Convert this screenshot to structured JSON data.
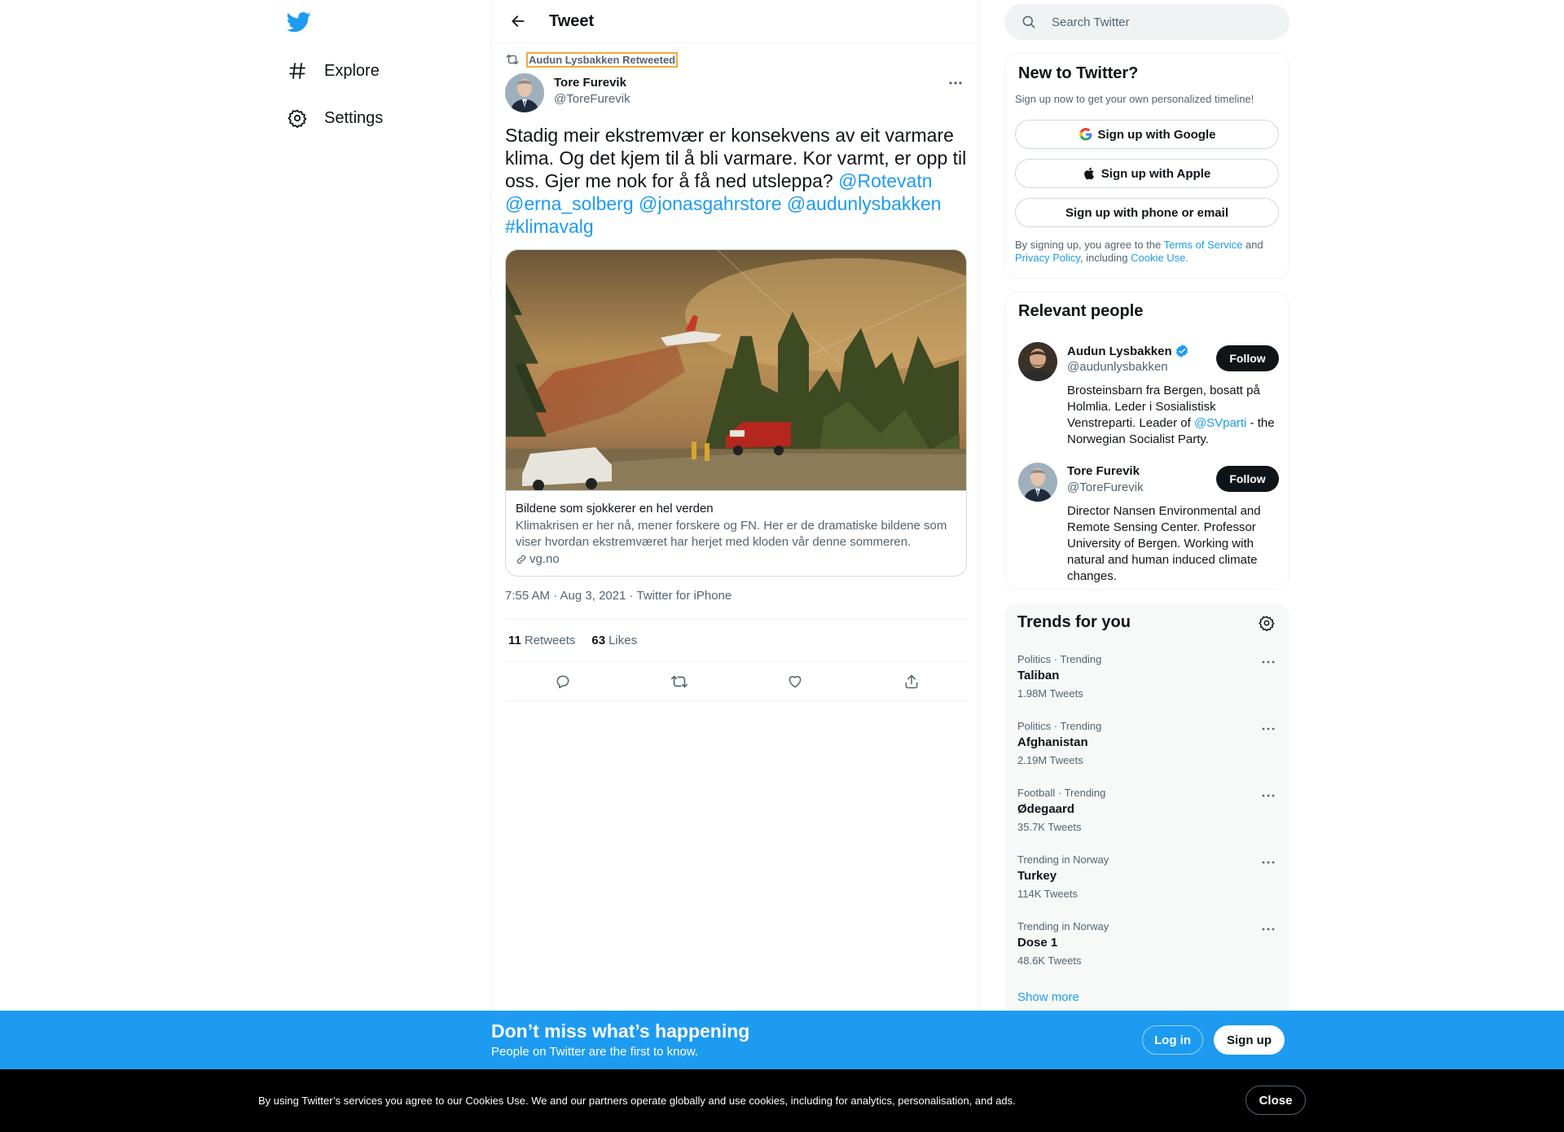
{
  "nav": {
    "items": [
      {
        "label": "Explore",
        "icon": "hashtag-icon"
      },
      {
        "label": "Settings",
        "icon": "gear-icon"
      }
    ]
  },
  "header": {
    "title": "Tweet"
  },
  "tweet": {
    "retweeted_by": "Audun Lysbakken Retweeted",
    "author_name": "Tore Furevik",
    "author_handle": "@ToreFurevik",
    "text_plain": "Stadig meir ekstremvær er konsekvens av eit varmare klima. Og det kjem til å bli varmare. Kor varmt, er opp til oss. Gjer me nok for å få ned utsleppa? ",
    "mentions": [
      "@Rotevatn",
      "@erna_solberg",
      "@jonasgahrstore",
      "@audunlysbakken"
    ],
    "hashtag": "#klimavalg",
    "card": {
      "title": "Bildene som sjokkerer en hel verden",
      "description": "Klimakrisen er her nå, mener forskere og FN. Her er de dramatiske bildene som viser hvordan ekstremværet har herjet med kloden vår denne sommeren.",
      "domain": "vg.no"
    },
    "meta": "7:55 AM · Aug 3, 2021 · Twitter for iPhone",
    "retweets_count": "11",
    "retweets_label": "Retweets",
    "likes_count": "63",
    "likes_label": "Likes"
  },
  "search": {
    "placeholder": "Search Twitter"
  },
  "new_to_twitter": {
    "title": "New to Twitter?",
    "subtitle": "Sign up now to get your own personalized timeline!",
    "google_label": "Sign up with Google",
    "apple_label": "Sign up with Apple",
    "phone_label": "Sign up with phone or email",
    "terms_1": "By signing up, you agree to the ",
    "terms_link": "Terms of Service",
    "terms_2": " and ",
    "privacy_link": "Privacy Policy",
    "terms_3": ", including ",
    "cookie_link": "Cookie Use."
  },
  "relevant": {
    "title": "Relevant people",
    "people": [
      {
        "name": "Audun Lysbakken",
        "handle": "@audunlysbakken",
        "verified": true,
        "bio_1": "Brosteinsbarn fra Bergen, bosatt på Holmlia. Leder i Sosialistisk Venstreparti. Leader of ",
        "bio_link": "@SVparti",
        "bio_2": " - the Norwegian Socialist Party.",
        "follow_label": "Follow"
      },
      {
        "name": "Tore Furevik",
        "handle": "@ToreFurevik",
        "verified": false,
        "bio_1": "Director Nansen Environmental and Remote Sensing Center. Professor University of Bergen. Working with natural and human induced climate changes.",
        "follow_label": "Follow"
      }
    ]
  },
  "trends": {
    "title": "Trends for you",
    "items": [
      {
        "category": "Politics · Trending",
        "name": "Taliban",
        "count": "1.98M Tweets"
      },
      {
        "category": "Politics · Trending",
        "name": "Afghanistan",
        "count": "2.19M Tweets"
      },
      {
        "category": "Football · Trending",
        "name": "Ødegaard",
        "count": "35.7K Tweets"
      },
      {
        "category": "Trending in Norway",
        "name": "Turkey",
        "count": "114K Tweets"
      },
      {
        "category": "Trending in Norway",
        "name": "Dose 1",
        "count": "48.6K Tweets"
      }
    ],
    "show_more": "Show more"
  },
  "banner": {
    "title": "Don’t miss what’s happening",
    "subtitle": "People on Twitter are the first to know.",
    "login_label": "Log in",
    "signup_label": "Sign up"
  },
  "cookie": {
    "text": "By using Twitter’s services you agree to our Cookies Use. We and our partners operate globally and use cookies, including for analytics, personalisation, and ads.",
    "close_label": "Close"
  },
  "colors": {
    "accent": "#1d9bf0",
    "text": "#0f1419",
    "muted": "#536471",
    "banner": "#1d9bf0",
    "cookie_bg": "#000000"
  }
}
